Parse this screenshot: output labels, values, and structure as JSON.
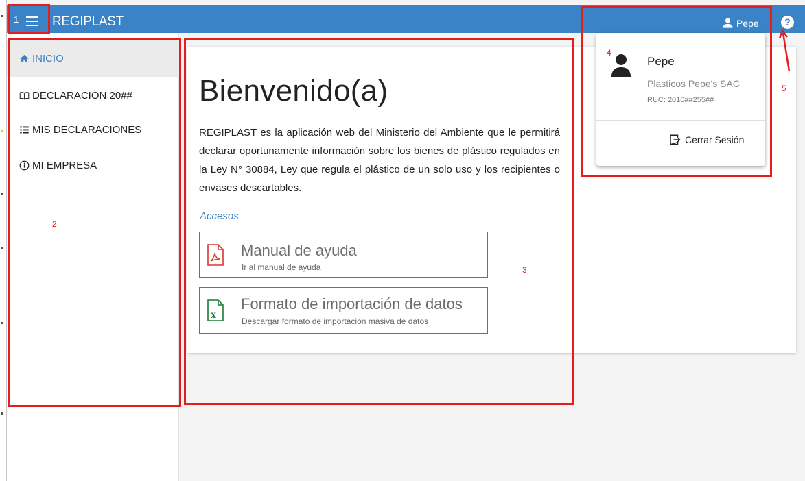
{
  "header": {
    "brand": "REGIPLAST",
    "user_name": "Pepe"
  },
  "sidebar": {
    "items": [
      {
        "label": "INICIO"
      },
      {
        "label": "DECLARACIÓN 20##"
      },
      {
        "label": "MIS DECLARACIONES"
      },
      {
        "label": "MI EMPRESA"
      }
    ]
  },
  "main": {
    "welcome_title": "Bienvenido(a)",
    "intro_text": "REGIPLAST es la aplicación web del Ministerio del Ambiente que le permitirá declarar oportunamente información sobre los bienes de plástico regulados en la Ley N° 30884, Ley que regula el plástico de un solo uso y los recipientes o envases descartables.",
    "accesos_label": "Accesos",
    "access_links": [
      {
        "title": "Manual de ayuda",
        "subtitle": "Ir al manual de ayuda",
        "icon": "pdf-icon"
      },
      {
        "title": "Formato de importación de datos",
        "subtitle": "Descargar formato de importación masiva de datos",
        "icon": "excel-icon"
      }
    ]
  },
  "user_menu": {
    "name": "Pepe",
    "company": "Plasticos Pepe's SAC",
    "ruc": "RUC: 2010##255##",
    "logout_label": "Cerrar Sesión"
  },
  "annotations": {
    "n1": "1",
    "n2": "2",
    "n3": "3",
    "n4": "4",
    "n5": "5"
  },
  "colors": {
    "primary": "#3a83c6",
    "annotation": "#e41d1d",
    "pdf": "#d23a2e",
    "excel": "#1d7a35"
  }
}
